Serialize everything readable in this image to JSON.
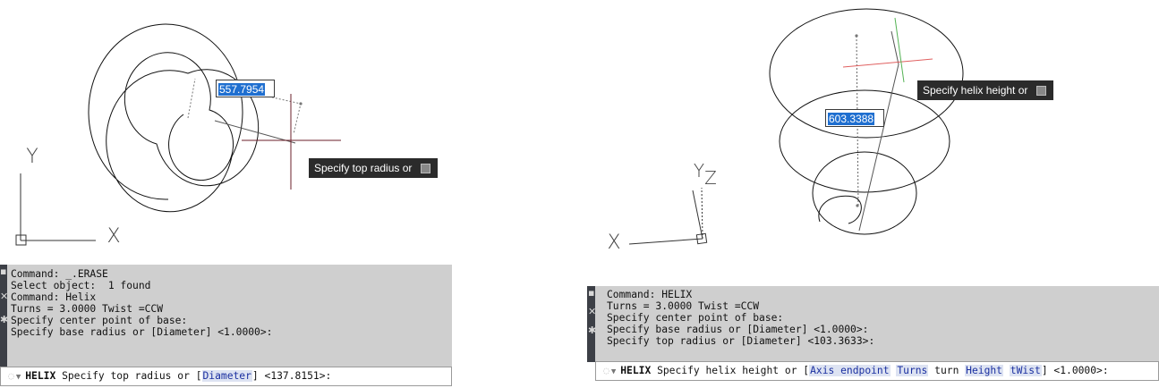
{
  "left": {
    "dynamic_input_value": "557.7954",
    "tooltip": "Specify top radius or",
    "axis_labels": {
      "y": "Y",
      "x": "X"
    },
    "history": [
      "Command: _.ERASE",
      "Select object:  1 found",
      "Command: Helix",
      "Turns = 3.0000 Twist =CCW",
      "Specify center point of base:",
      "Specify base radius or [Diameter] <1.0000>:"
    ],
    "prompt": {
      "command": "HELIX",
      "before": "Specify top radius or [",
      "option": "Diameter",
      "after": "] <137.8151>:"
    }
  },
  "right": {
    "dynamic_input_value": "603.3388",
    "tooltip": "Specify helix height or",
    "axis_labels": {
      "y": "Y",
      "z": "Z",
      "x": "X"
    },
    "history": [
      "Command: HELIX",
      "Turns = 3.0000 Twist =CCW",
      "Specify center point of base:",
      "Specify base radius or [Diameter] <1.0000>:",
      "Specify top radius or [Diameter] <103.3633>:"
    ],
    "prompt": {
      "command": "HELIX",
      "t1": "Specify helix height or [",
      "o1": "Axis endpoint",
      "t2": " ",
      "o2": "Turns",
      "t3": " turn ",
      "o3": "Height",
      "t4": " ",
      "o4": "tWist",
      "t5": "] <1.0000>:"
    }
  },
  "side_icons": {
    "grip": "grip-icon",
    "close": "close-icon",
    "customize": "wrench-icon",
    "command": "command-icon",
    "arrow": "chevron-down-icon"
  },
  "colors": {
    "history_bg": "#cfcfcf",
    "sidebar": "#3c3f46",
    "tooltip_bg": "#2b2b2b",
    "highlight": "#1f6fd0",
    "crosshair": "#6b1f2a"
  }
}
